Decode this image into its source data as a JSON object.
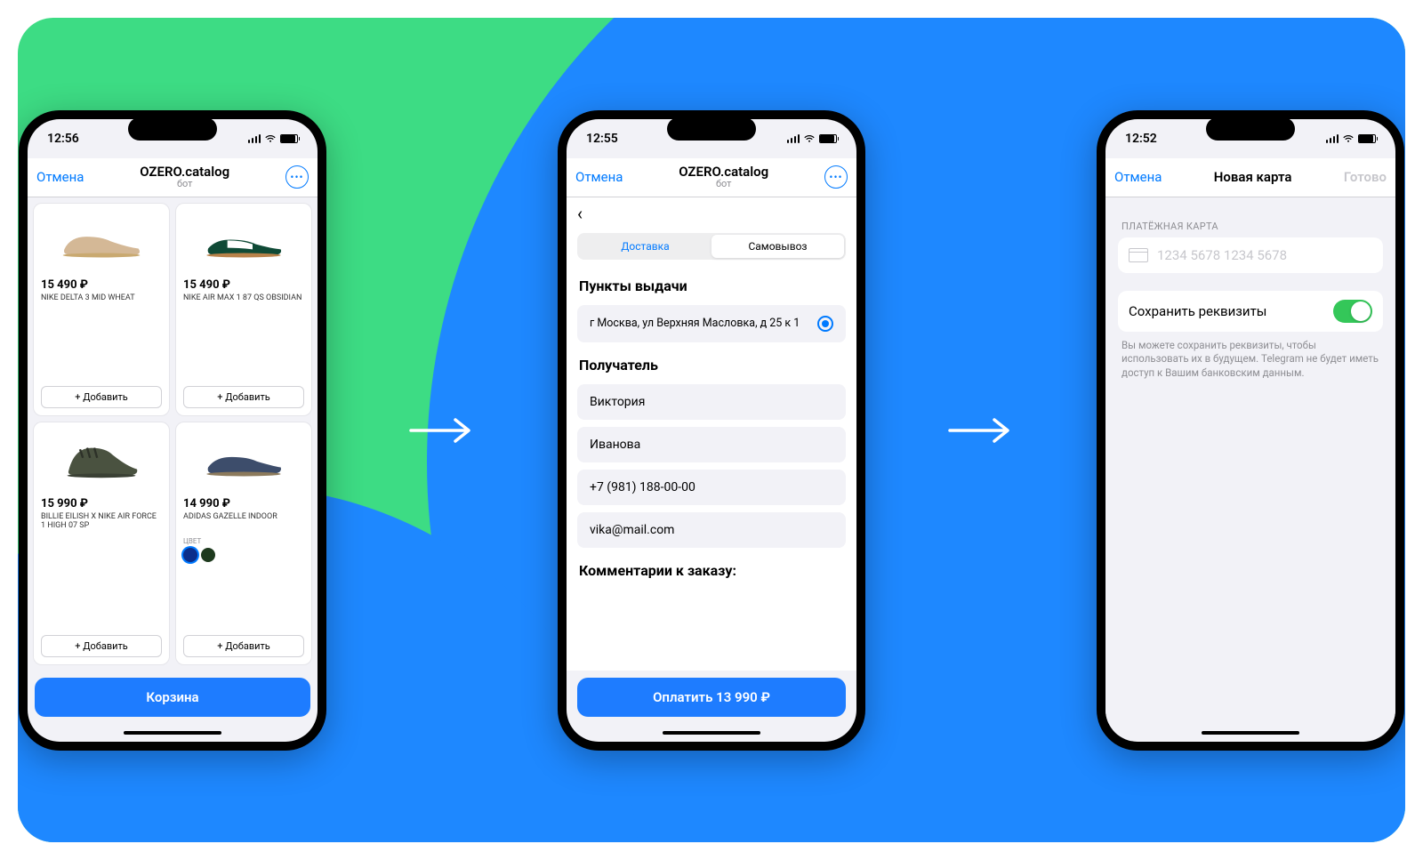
{
  "screen1": {
    "status_time": "12:56",
    "nav_cancel": "Отмена",
    "nav_title": "OZERO.catalog",
    "nav_subtitle": "бот",
    "products": [
      {
        "price": "15 490 ₽",
        "name": "NIKE DELTA 3 MID WHEAT"
      },
      {
        "price": "15 490 ₽",
        "name": "NIKE AIR MAX 1 87 QS OBSIDIAN"
      },
      {
        "price": "15 990 ₽",
        "name": "BILLIE EILISH X NIKE AIR FORCE 1 HIGH 07 SP"
      },
      {
        "price": "14 990 ₽",
        "name": "ADIDAS GAZELLE INDOOR",
        "color_label": "ЦВЕТ",
        "swatches": [
          "#0b2e8a",
          "#1e3a1e"
        ]
      }
    ],
    "add_label": "Добавить",
    "cart_label": "Корзина"
  },
  "screen2": {
    "status_time": "12:55",
    "nav_cancel": "Отмена",
    "nav_title": "OZERO.catalog",
    "nav_subtitle": "бот",
    "tabs": {
      "delivery": "Доставка",
      "pickup": "Самовывоз"
    },
    "pickup_heading": "Пункты выдачи",
    "pickup_address": "г Москва, ул Верхняя Масловка, д 25 к 1",
    "recipient_heading": "Получатель",
    "recipient": {
      "first": "Виктория",
      "last": "Иванова",
      "phone": "+7 (981) 188-00-00",
      "email": "vika@mail.com"
    },
    "comments_heading": "Комментарии к заказу:",
    "pay_label": "Оплатить 13 990 ₽"
  },
  "screen3": {
    "status_time": "12:52",
    "nav_cancel": "Отмена",
    "nav_title": "Новая карта",
    "nav_done": "Готово",
    "section_label": "ПЛАТЁЖНАЯ КАРТА",
    "card_placeholder": "1234 5678 1234 5678",
    "save_label": "Сохранить реквизиты",
    "hint": "Вы можете сохранить реквизиты, чтобы использовать их в будущем. Telegram не будет иметь доступ к Вашим банковским данным."
  }
}
